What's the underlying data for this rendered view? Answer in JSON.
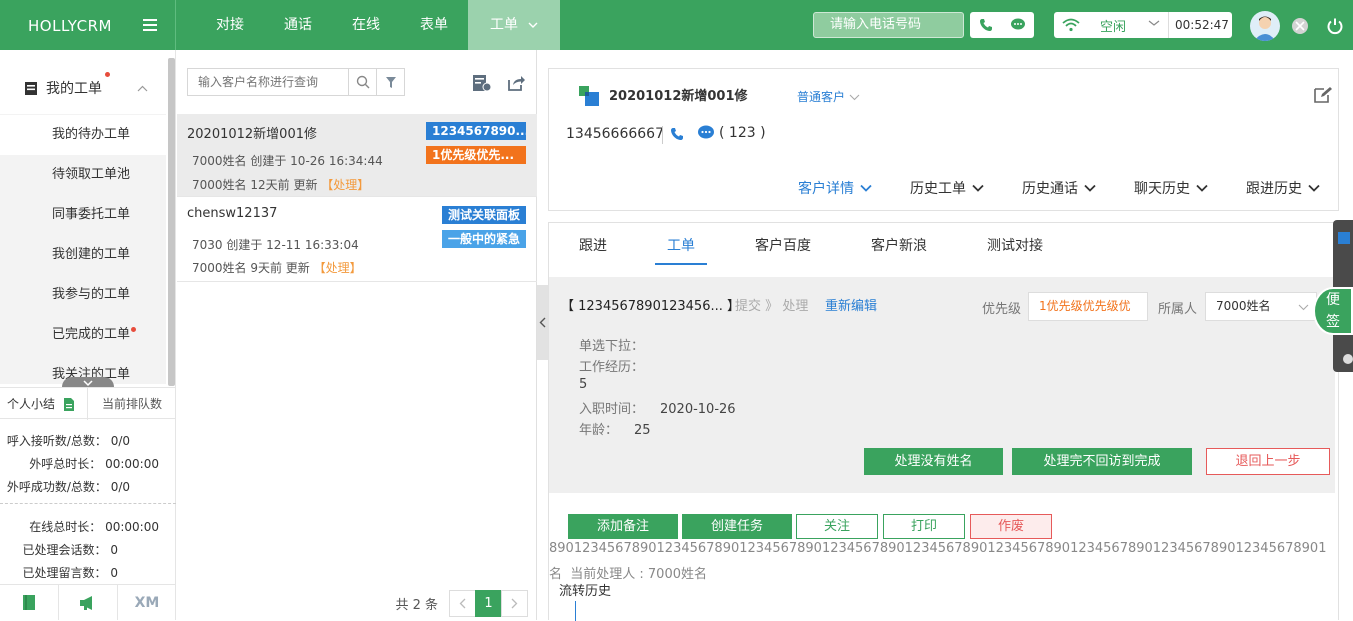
{
  "app": {
    "brand": "HOLLYCRM"
  },
  "nav": [
    "对接",
    "通话",
    "在线",
    "表单",
    "工单"
  ],
  "nav_active": 4,
  "topbar": {
    "phone_placeholder": "请输入电话号码",
    "status": "空闲",
    "timer": "00:52:47"
  },
  "sidebar": {
    "section": "我的工单",
    "items": [
      "我的待办工单",
      "待领取工单池",
      "同事委托工单",
      "我创建的工单",
      "我参与的工单",
      "已完成的工单",
      "我关注的工单"
    ],
    "active_index": 0,
    "stats_tabs": [
      "个人小结",
      "当前排队数"
    ],
    "stats": [
      {
        "label": "呼入接听数/总数：",
        "value": "0/0"
      },
      {
        "label": "外呼总时长：",
        "value": "00:00:00"
      },
      {
        "label": "外呼成功数/总数：",
        "value": "0/0"
      },
      {
        "label": "在线总时长：",
        "value": "00:00:00"
      },
      {
        "label": "已处理会话数：",
        "value": "0"
      },
      {
        "label": "已处理留言数：",
        "value": "0"
      }
    ],
    "footer_xm": "XM"
  },
  "list": {
    "search_placeholder": "输入客户名称进行查询",
    "rows": [
      {
        "title": "20201012新增001修",
        "meta1": "7000姓名 创建于 10-26 16:34:44",
        "meta2": "7000姓名 12天前 更新",
        "action": "【处理】",
        "tag1": "1234567890...",
        "tag1_color": "#2a7fd4",
        "tag2": "1优先级优先...",
        "tag2_color": "#f2731c"
      },
      {
        "title": "chensw12137",
        "meta1": "7030 创建于 12-11 16:33:04",
        "meta2": "7000姓名 9天前 更新",
        "action": "【处理】",
        "tag1": "测试关联面板",
        "tag1_color": "#2a7fd4",
        "tag2": "一般中的紧急",
        "tag2_color": "#4aa3e8"
      }
    ],
    "total": "共 2 条",
    "page": "1"
  },
  "customer": {
    "name": "20201012新增001修",
    "type": "普通客户",
    "phone": "13456666667",
    "wechat": "( 123 )",
    "tabs": [
      "客户详情",
      "历史工单",
      "历史通话",
      "聊天历史",
      "跟进历史"
    ]
  },
  "subtabs": [
    "跟进",
    "工单",
    "客户百度",
    "客户新浪",
    "测试对接"
  ],
  "subtab_active": 1,
  "ticket": {
    "id": "【 1234567890123456... 】",
    "steps": [
      "提交",
      "》",
      "处理"
    ],
    "reedit": "重新编辑",
    "priority_label": "优先级",
    "priority_value": "1优先级优先级优",
    "owner_label": "所属人",
    "owner_value": "7000姓名",
    "fields": [
      {
        "label": "单选下拉：",
        "value": ""
      },
      {
        "label": "工作经历：",
        "value": ""
      },
      {
        "label": "5",
        "value": ""
      },
      {
        "label": "入职时间：",
        "value": "2020-10-26"
      },
      {
        "label": "年龄：",
        "value": "25"
      }
    ],
    "actions": [
      "处理没有姓名",
      "处理完不回访到完成",
      "退回上一步"
    ]
  },
  "ops": [
    "添加备注",
    "创建任务",
    "关注",
    "打印",
    "作废"
  ],
  "long_text": "8901234567890123456789012345678901234567890123456789012345678901234567890123456789012345678901",
  "handler": "名  当前处理人 : 7000姓名",
  "flow_history": "流转历史",
  "float": {
    "bian": "便",
    "qian": "签"
  }
}
